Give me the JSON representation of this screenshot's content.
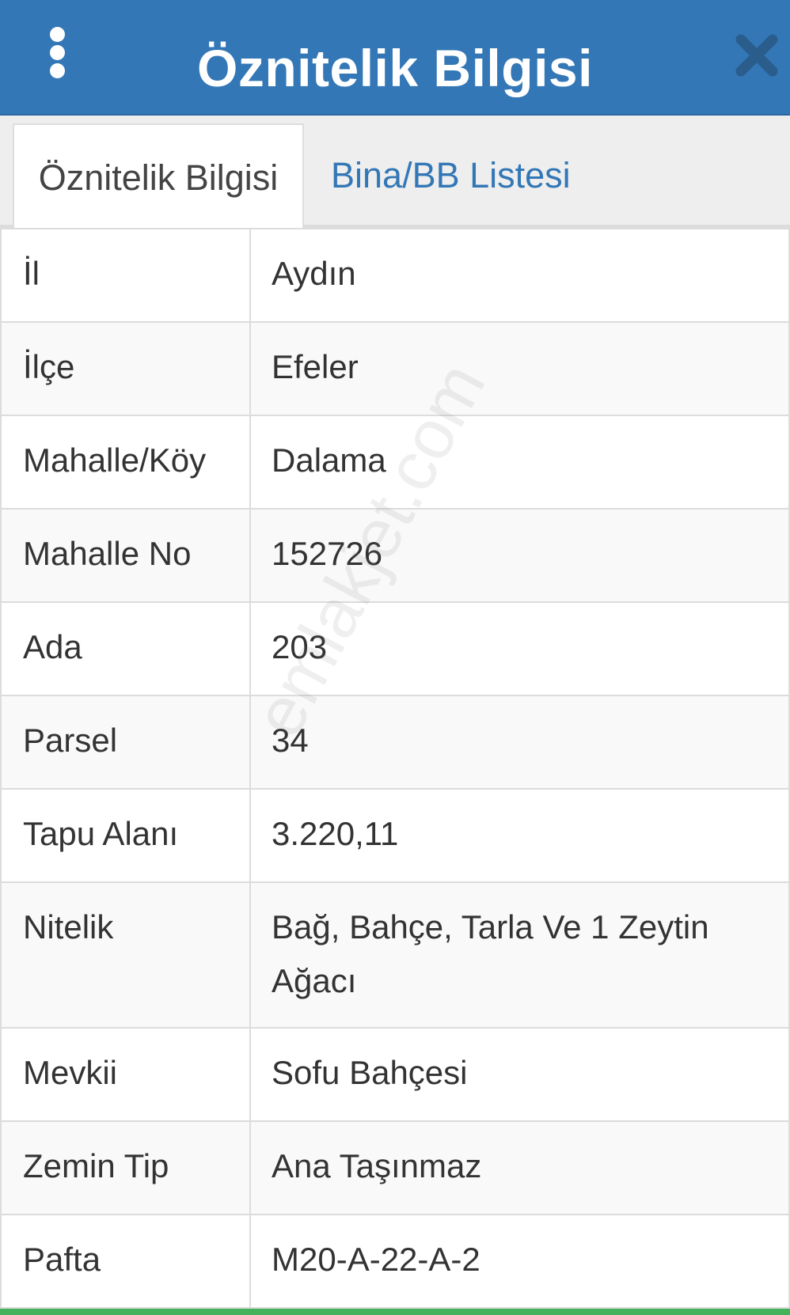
{
  "header": {
    "title": "Öznitelik Bilgisi",
    "menu_icon": "more-vert-icon",
    "close_icon": "close-icon",
    "background_color": "#3377b6"
  },
  "tabs": [
    {
      "label": "Öznitelik Bilgisi",
      "active": true
    },
    {
      "label": "Bina/BB Listesi",
      "active": false
    }
  ],
  "attributes": [
    {
      "label": "İl",
      "value": "Aydın"
    },
    {
      "label": "İlçe",
      "value": "Efeler"
    },
    {
      "label": "Mahalle/Köy",
      "value": "Dalama"
    },
    {
      "label": "Mahalle No",
      "value": "152726"
    },
    {
      "label": "Ada",
      "value": "203"
    },
    {
      "label": "Parsel",
      "value": "34"
    },
    {
      "label": "Tapu Alanı",
      "value": "3.220,11"
    },
    {
      "label": "Nitelik",
      "value": "Bağ, Bahçe, Tarla Ve 1 Zeytin Ağacı"
    },
    {
      "label": "Mevkii",
      "value": "Sofu Bahçesi"
    },
    {
      "label": "Zemin Tip",
      "value": "Ana Taşınmaz"
    },
    {
      "label": "Pafta",
      "value": "M20-A-22-A-2"
    }
  ],
  "watermark": "emlakjet.com"
}
